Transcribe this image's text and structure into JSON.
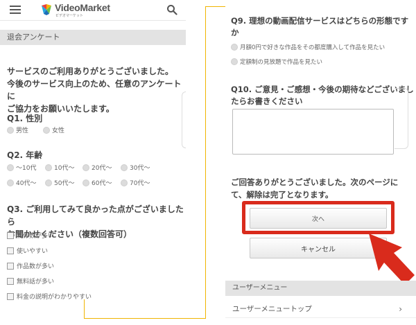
{
  "header": {
    "brand": "VideoMarket",
    "brand_sub": "ビデオマーケット",
    "menu_icon": "hamburger-icon",
    "search_icon": "search-icon"
  },
  "left": {
    "section_title": "退会アンケート",
    "intro_lines": [
      "サービスのご利用ありがとうございました。",
      "今後のサービス向上のため、任意のアンケートに",
      "ご協力をお願いいたします。"
    ],
    "q1": {
      "label": "Q1. 性別",
      "options": [
        "男性",
        "女性"
      ]
    },
    "q2": {
      "label": "Q2. 年齢",
      "options": [
        "〜10代",
        "10代〜",
        "20代〜",
        "30代〜",
        "40代〜",
        "50代〜",
        "60代〜",
        "70代〜"
      ]
    },
    "q3": {
      "label_lines": [
        "Q3. ご利用してみて良かった点がございましたら",
        "お聞かせください（複数回答可）"
      ],
      "options": [
        "新作数が多い",
        "使いやすい",
        "作品数が多い",
        "無料話が多い",
        "料金の説明がわかりやすい"
      ]
    }
  },
  "right": {
    "q9": {
      "label_lines": [
        "Q9. 理想の動画配信サービスはどちらの形態です",
        "か"
      ],
      "options": [
        "月額0円で好きな作品をその都度購入して作品を見たい",
        "定額制の見放題で作品を見たい"
      ]
    },
    "q10": {
      "label_lines": [
        "Q10. ご意見・ご感想・今後の期待などございまし",
        "たらお書きください"
      ],
      "value": ""
    },
    "done_lines": [
      "ご回答ありがとうございました。次のページに",
      "て、解除は完了となります。"
    ],
    "next_label": "次へ",
    "cancel_label": "キャンセル",
    "menu_title": "ユーザーメニュー",
    "menu_item": "ユーザーメニュートップ",
    "menu_chevron": "›"
  },
  "colors": {
    "highlight_red": "#d92b1c",
    "connector_yellow": "#f0b400",
    "section_gray": "#e3e3e3"
  }
}
